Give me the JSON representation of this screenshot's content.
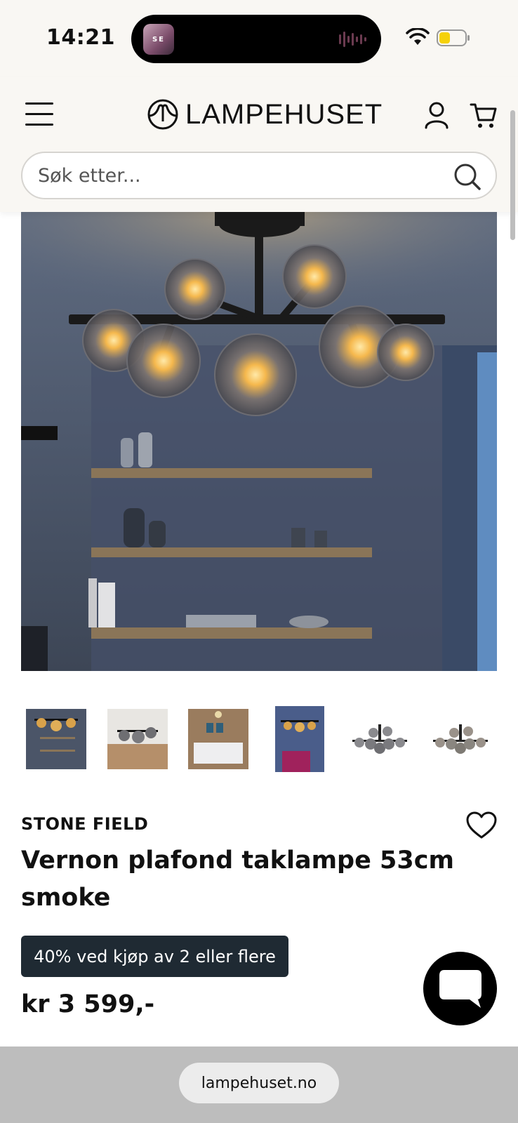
{
  "status_bar": {
    "time": "14:21",
    "island_app_label": "SE",
    "icons": [
      "wifi-icon",
      "battery-icon",
      "audio-wave-icon"
    ],
    "battery_color": "#f5d10a"
  },
  "header": {
    "logo_text": "LAMPEHUSET",
    "icons": [
      "menu-icon",
      "logo-icon",
      "account-icon",
      "cart-icon"
    ],
    "search": {
      "placeholder": "Søk etter...",
      "value": "",
      "icon": "search-icon"
    }
  },
  "gallery": {
    "thumbnail_count": 6
  },
  "product": {
    "brand": "STONE FIELD",
    "title": "Vernon plafond taklampe 53cm smoke",
    "promo": "40% ved kjøp av 2 eller flere",
    "price": "kr 3 599,-",
    "promo_color": "#1f2a33",
    "wishlist_icon": "heart-icon"
  },
  "chat": {
    "icon": "chat-bubble-icon"
  },
  "browser": {
    "url": "lampehuset.no"
  }
}
